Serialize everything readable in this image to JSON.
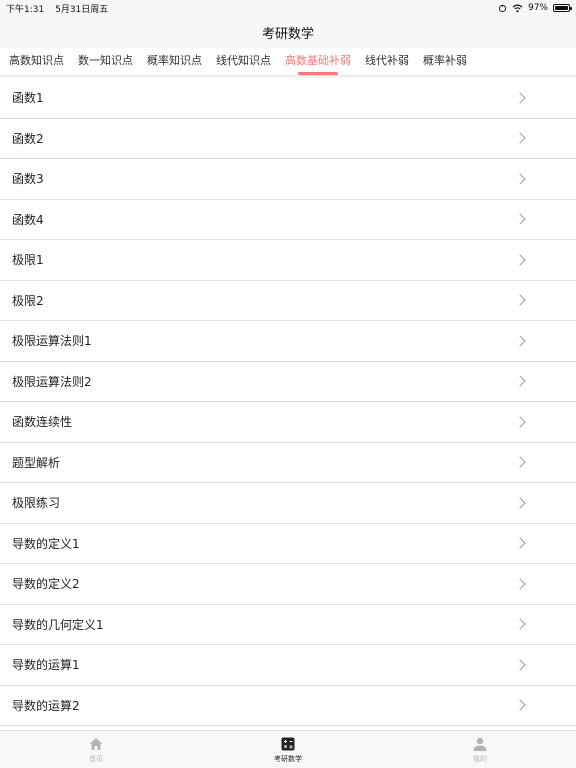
{
  "status_bar": {
    "time": "下午1:31",
    "date": "5月31日周五",
    "battery_level": "97%",
    "battery_fraction": 0.97
  },
  "nav": {
    "title": "考研数学"
  },
  "tabs": [
    {
      "label": "高数知识点",
      "active": false
    },
    {
      "label": "数一知识点",
      "active": false
    },
    {
      "label": "概率知识点",
      "active": false
    },
    {
      "label": "线代知识点",
      "active": false
    },
    {
      "label": "高数基础补弱",
      "active": true
    },
    {
      "label": "线代补弱",
      "active": false
    },
    {
      "label": "概率补弱",
      "active": false
    }
  ],
  "list_items": [
    "函数1",
    "函数2",
    "函数3",
    "函数4",
    "极限1",
    "极限2",
    "极限运算法则1",
    "极限运算法则2",
    "函数连续性",
    "题型解析",
    "极限练习",
    "导数的定义1",
    "导数的定义2",
    "导数的几何定义1",
    "导数的运算1",
    "导数的运算2"
  ],
  "tab_bar": [
    {
      "label": "首页",
      "icon": "home-icon",
      "active": false
    },
    {
      "label": "考研数学",
      "icon": "calculator-icon",
      "active": true
    },
    {
      "label": "我的",
      "icon": "person-icon",
      "active": false
    }
  ],
  "colors": {
    "accent": "#f07b7b",
    "inactive": "#b3b3b3"
  }
}
